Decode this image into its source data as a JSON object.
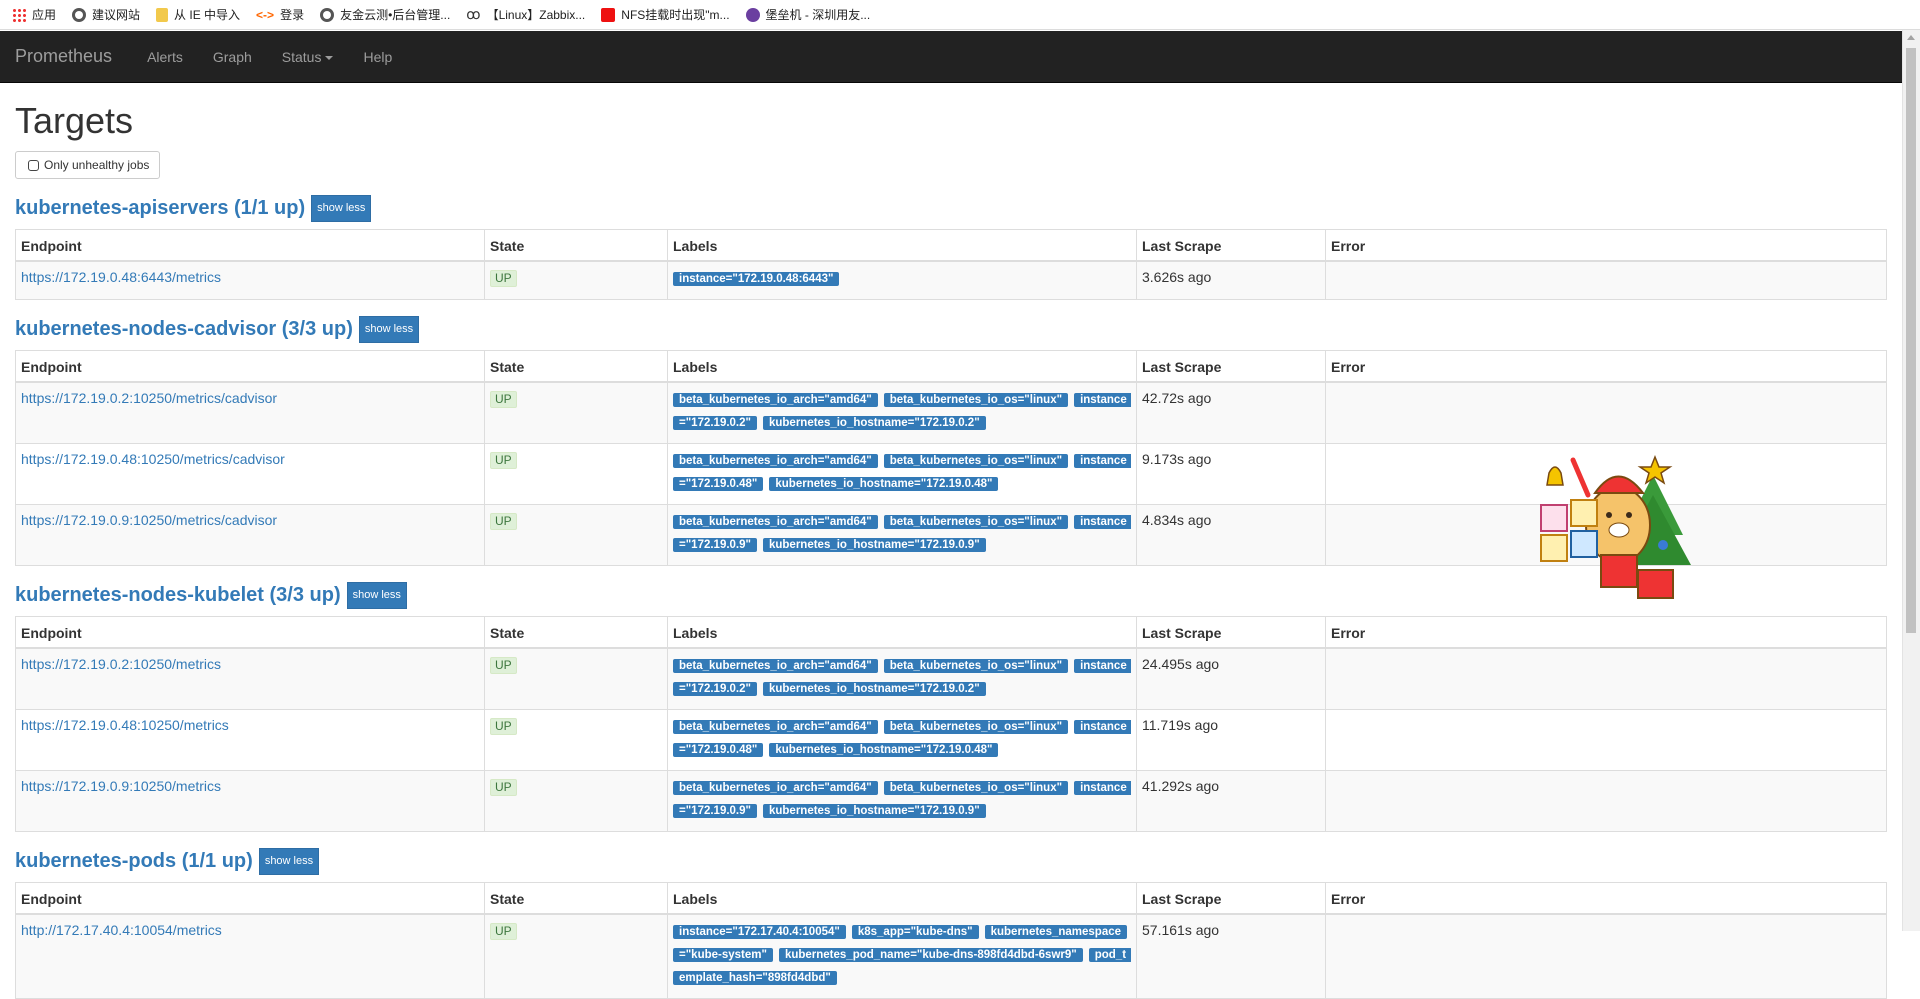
{
  "bookmarks": [
    {
      "label": "应用",
      "icon": "apps-icon"
    },
    {
      "label": "建议网站",
      "icon": "globe-icon"
    },
    {
      "label": "从 IE 中导入",
      "icon": "folder-icon"
    },
    {
      "label": "登录",
      "icon": "login-icon"
    },
    {
      "label": "友金云测•后台管理...",
      "icon": "globe-icon"
    },
    {
      "label": "【Linux】Zabbix...",
      "icon": "zabbix-icon"
    },
    {
      "label": "NFS挂载时出现\"m...",
      "icon": "csdn-icon"
    },
    {
      "label": "堡垒机 - 深圳用友...",
      "icon": "shield-icon"
    }
  ],
  "navbar": {
    "brand": "Prometheus",
    "alerts": "Alerts",
    "graph": "Graph",
    "status": "Status",
    "help": "Help"
  },
  "page": {
    "title": "Targets",
    "filter_label": "Only unhealthy jobs"
  },
  "columns": {
    "endpoint": "Endpoint",
    "state": "State",
    "labels": "Labels",
    "last_scrape": "Last Scrape",
    "error": "Error"
  },
  "jobs": [
    {
      "title": "kubernetes-apiservers (1/1 up)",
      "button": "show less",
      "targets": [
        {
          "endpoint": "https://172.19.0.48:6443/metrics",
          "state": "UP",
          "labels": [
            "instance=\"172.19.0.48:6443\""
          ],
          "last_scrape": "3.626s ago",
          "error": ""
        }
      ]
    },
    {
      "title": "kubernetes-nodes-cadvisor (3/3 up)",
      "button": "show less",
      "targets": [
        {
          "endpoint": "https://172.19.0.2:10250/metrics/cadvisor",
          "state": "UP",
          "labels": [
            "beta_kubernetes_io_arch=\"amd64\"",
            "beta_kubernetes_io_os=\"linux\"",
            "instance=\"172.19.0.2\"",
            "kubernetes_io_hostname=\"172.19.0.2\""
          ],
          "last_scrape": "42.72s ago",
          "error": ""
        },
        {
          "endpoint": "https://172.19.0.48:10250/metrics/cadvisor",
          "state": "UP",
          "labels": [
            "beta_kubernetes_io_arch=\"amd64\"",
            "beta_kubernetes_io_os=\"linux\"",
            "instance=\"172.19.0.48\"",
            "kubernetes_io_hostname=\"172.19.0.48\""
          ],
          "last_scrape": "9.173s ago",
          "error": ""
        },
        {
          "endpoint": "https://172.19.0.9:10250/metrics/cadvisor",
          "state": "UP",
          "labels": [
            "beta_kubernetes_io_arch=\"amd64\"",
            "beta_kubernetes_io_os=\"linux\"",
            "instance=\"172.19.0.9\"",
            "kubernetes_io_hostname=\"172.19.0.9\""
          ],
          "last_scrape": "4.834s ago",
          "error": ""
        }
      ]
    },
    {
      "title": "kubernetes-nodes-kubelet (3/3 up)",
      "button": "show less",
      "targets": [
        {
          "endpoint": "https://172.19.0.2:10250/metrics",
          "state": "UP",
          "labels": [
            "beta_kubernetes_io_arch=\"amd64\"",
            "beta_kubernetes_io_os=\"linux\"",
            "instance=\"172.19.0.2\"",
            "kubernetes_io_hostname=\"172.19.0.2\""
          ],
          "last_scrape": "24.495s ago",
          "error": ""
        },
        {
          "endpoint": "https://172.19.0.48:10250/metrics",
          "state": "UP",
          "labels": [
            "beta_kubernetes_io_arch=\"amd64\"",
            "beta_kubernetes_io_os=\"linux\"",
            "instance=\"172.19.0.48\"",
            "kubernetes_io_hostname=\"172.19.0.48\""
          ],
          "last_scrape": "11.719s ago",
          "error": ""
        },
        {
          "endpoint": "https://172.19.0.9:10250/metrics",
          "state": "UP",
          "labels": [
            "beta_kubernetes_io_arch=\"amd64\"",
            "beta_kubernetes_io_os=\"linux\"",
            "instance=\"172.19.0.9\"",
            "kubernetes_io_hostname=\"172.19.0.9\""
          ],
          "last_scrape": "41.292s ago",
          "error": ""
        }
      ]
    },
    {
      "title": "kubernetes-pods (1/1 up)",
      "button": "show less",
      "targets": [
        {
          "endpoint": "http://172.17.40.4:10054/metrics",
          "state": "UP",
          "labels": [
            "instance=\"172.17.40.4:10054\"",
            "k8s_app=\"kube-dns\"",
            "kubernetes_namespace=\"kube-system\"",
            "kubernetes_pod_name=\"kube-dns-898fd4dbd-6swr9\"",
            "pod_template_hash=\"898fd4dbd\""
          ],
          "last_scrape": "57.161s ago",
          "error": ""
        }
      ]
    }
  ]
}
